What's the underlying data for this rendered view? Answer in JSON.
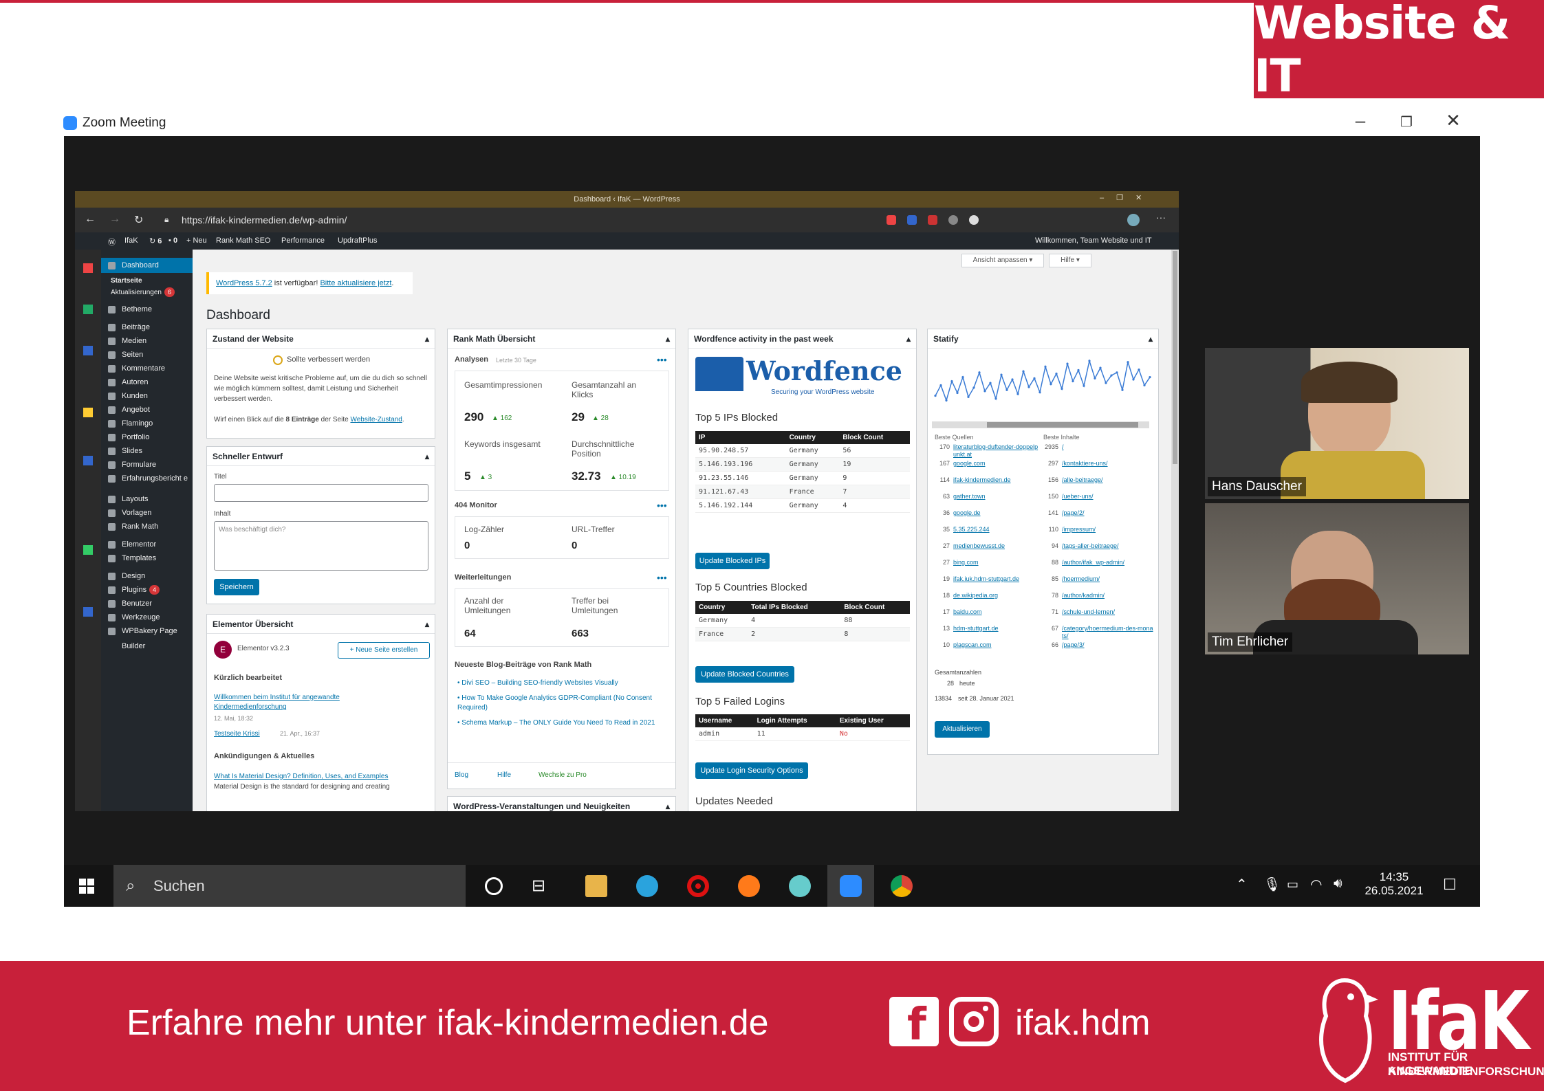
{
  "slide": {
    "badge": "Website & IT",
    "footer_text": "Erfahre mehr unter ifak-kindermedien.de",
    "social_handle": "ifak.hdm",
    "logo_word": "IfaK",
    "logo_sub1": "INSTITUT FÜR ANGEWANDTE",
    "logo_sub2": "KINDERMEDIENFORSCHUNG",
    "accent": "#c8203a"
  },
  "zoom": {
    "title": "Zoom Meeting",
    "participants": [
      {
        "name": "Hans Dauscher"
      },
      {
        "name": "Tim Ehrlicher"
      }
    ]
  },
  "browser": {
    "tab_title": "Dashboard ‹ IfaK — WordPress",
    "url": "https://ifak-kindermedien.de/wp-admin/"
  },
  "adminbar": {
    "site": "IfaK",
    "updates": "6",
    "comments": "0",
    "new": "+ Neu",
    "rank": "Rank Math SEO",
    "perf": "Performance",
    "updraft": "UpdraftPlus",
    "welcome": "Willkommen, Team Website und IT"
  },
  "sidebar": {
    "items": [
      "Dashboard",
      "Startseite",
      "Aktualisierungen",
      "Betheme",
      "Beiträge",
      "Medien",
      "Seiten",
      "Kommentare",
      "Autoren",
      "Kunden",
      "Angebot",
      "Flamingo",
      "Portfolio",
      "Slides",
      "Formulare",
      "Erfahrungsbericht e",
      "Layouts",
      "Vorlagen",
      "Rank Math",
      "Elementor",
      "Templates",
      "Design",
      "Plugins",
      "Benutzer",
      "Werkzeuge",
      "WPBakery Page Builder"
    ],
    "update_badge": "6",
    "plugins_badge": "4"
  },
  "dashboard": {
    "screen_options": "Ansicht anpassen ▾",
    "help": "Hilfe ▾",
    "notice": {
      "prefix": "WordPress 5.7.2",
      "middle": " ist verfügbar! ",
      "link": "Bitte aktualisiere jetzt",
      "suffix": "."
    },
    "heading": "Dashboard",
    "health": {
      "title": "Zustand der Website",
      "status": "Sollte verbessert werden",
      "body": "Deine Website weist kritische Probleme auf, um die du dich so schnell wie möglich kümmern solltest, damit Leistung und Sicherheit verbessert werden.",
      "hint_prefix": "Wirf einen Blick auf die ",
      "hint_bold": "8 Einträge",
      "hint_mid": " der Seite ",
      "hint_link": "Website-Zustand",
      "hint_end": "."
    },
    "draft": {
      "title": "Schneller Entwurf",
      "title_label": "Titel",
      "content_label": "Inhalt",
      "placeholder": "Was beschäftigt dich?",
      "save": "Speichern"
    },
    "elementor": {
      "title": "Elementor Übersicht",
      "version": "Elementor v3.2.3",
      "new_page": "+ Neue Seite erstellen",
      "recent_heading": "Kürzlich bearbeitet",
      "recent1": "Willkommen beim Institut für angewandte Kindermedienforschung",
      "recent1_date": "12. Mai, 18:32",
      "recent2": "Testseite Krissi",
      "recent2_date": "21. Apr., 16:37",
      "news_heading": "Ankündigungen & Aktuelles",
      "news1": "What Is Material Design? Definition, Uses, and Examples",
      "news1_sub": "Material Design is the standard for designing and creating"
    },
    "rankmath": {
      "title": "Rank Math Übersicht",
      "analysen": "Analysen",
      "period": "Letzte 30 Tage",
      "stats": [
        {
          "label": "Gesamtimpressionen",
          "value": "290",
          "delta": "▲ 162"
        },
        {
          "label": "Gesamtanzahl an Klicks",
          "value": "29",
          "delta": "▲ 28"
        },
        {
          "label": "Keywords insgesamt",
          "value": "5",
          "delta": "▲ 3"
        },
        {
          "label": "Durchschnittliche Position",
          "value": "32.73",
          "delta": "▲ 10.19"
        }
      ],
      "monitor": "404 Monitor",
      "log": {
        "label": "Log-Zähler",
        "value": "0"
      },
      "hits": {
        "label": "URL-Treffer",
        "value": "0"
      },
      "redirects": "Weiterleitungen",
      "redir_count": {
        "label": "Anzahl der Umleitungen",
        "value": "64"
      },
      "redir_hits": {
        "label": "Treffer bei Umleitungen",
        "value": "663"
      },
      "blog_heading": "Neueste Blog-Beiträge von Rank Math",
      "posts": [
        "Divi SEO – Building SEO-friendly Websites Visually",
        "How To Make Google Analytics GDPR-Compliant (No Consent Required)",
        "Schema Markup – The ONLY Guide You Need To Read in 2021"
      ],
      "foot_blog": "Blog",
      "foot_help": "Hilfe",
      "foot_pro": "Wechsle zu Pro",
      "events": "WordPress-Veranstaltungen und Neuigkeiten"
    },
    "wordfence": {
      "title": "Wordfence activity in the past week",
      "logo": "Wordfence",
      "tagline": "Securing your WordPress website",
      "ips_heading": "Top 5 IPs Blocked",
      "ips_cols": [
        "IP",
        "Country",
        "Block Count"
      ],
      "ips": [
        [
          "95.90.248.57",
          "Germany",
          "56"
        ],
        [
          "5.146.193.196",
          "Germany",
          "19"
        ],
        [
          "91.23.55.146",
          "Germany",
          "9"
        ],
        [
          "91.121.67.43",
          "France",
          "7"
        ],
        [
          "5.146.192.144",
          "Germany",
          "4"
        ]
      ],
      "ips_btn": "Update Blocked IPs",
      "countries_heading": "Top 5 Countries Blocked",
      "countries_cols": [
        "Country",
        "Total IPs Blocked",
        "Block Count"
      ],
      "countries": [
        [
          "Germany",
          "4",
          "88"
        ],
        [
          "France",
          "2",
          "8"
        ]
      ],
      "countries_btn": "Update Blocked Countries",
      "logins_heading": "Top 5 Failed Logins",
      "logins_cols": [
        "Username",
        "Login Attempts",
        "Existing User"
      ],
      "logins": [
        [
          "admin",
          "11",
          "No"
        ]
      ],
      "logins_btn": "Update Login Security Options",
      "updates_heading": "Updates Needed"
    },
    "statify": {
      "title": "Statify",
      "sources_heading": "Beste Quellen",
      "content_heading": "Beste Inhalte",
      "sources": [
        [
          "170",
          "literaturblog-duftender-doppelpunkt.at"
        ],
        [
          "167",
          "google.com"
        ],
        [
          "114",
          "ifak-kindermedien.de"
        ],
        [
          "63",
          "gather.town"
        ],
        [
          "36",
          "google.de"
        ],
        [
          "35",
          "5.35.225.244"
        ],
        [
          "27",
          "medienbewusst.de"
        ],
        [
          "27",
          "bing.com"
        ],
        [
          "19",
          "ifak.iuk.hdm-stuttgart.de"
        ],
        [
          "18",
          "de.wikipedia.org"
        ],
        [
          "17",
          "baidu.com"
        ],
        [
          "13",
          "hdm-stuttgart.de"
        ],
        [
          "10",
          "plagscan.com"
        ]
      ],
      "contents": [
        [
          "2935",
          "/"
        ],
        [
          "297",
          "/kontaktiere-uns/"
        ],
        [
          "156",
          "/alle-beitraege/"
        ],
        [
          "150",
          "/ueber-uns/"
        ],
        [
          "141",
          "/page/2/"
        ],
        [
          "110",
          "/impressum/"
        ],
        [
          "94",
          "/tags-aller-beitraege/"
        ],
        [
          "88",
          "/author/ifak_wp-admin/"
        ],
        [
          "85",
          "/hoermedium/"
        ],
        [
          "78",
          "/author/kadmin/"
        ],
        [
          "71",
          "/schule-und-lernen/"
        ],
        [
          "67",
          "/category/hoermedium-des-monats/"
        ],
        [
          "66",
          "/page/3/"
        ]
      ],
      "totals_heading": "Gesamtanzahlen",
      "today_count": "28",
      "today_label": "heute",
      "since_count": "13834",
      "since_label": "seit 28. Januar 2021",
      "refresh": "Aktualisieren",
      "sparkline": [
        30,
        48,
        22,
        55,
        35,
        62,
        28,
        44,
        70,
        38,
        52,
        25,
        66,
        40,
        58,
        33,
        72,
        45,
        60,
        36,
        80,
        50,
        68,
        42,
        85,
        55,
        74,
        47,
        90,
        60,
        78,
        52,
        65,
        70,
        40,
        88,
        58,
        75,
        48,
        62
      ]
    }
  },
  "taskbar": {
    "search": "Suchen",
    "time": "14:35",
    "date": "26.05.2021"
  }
}
